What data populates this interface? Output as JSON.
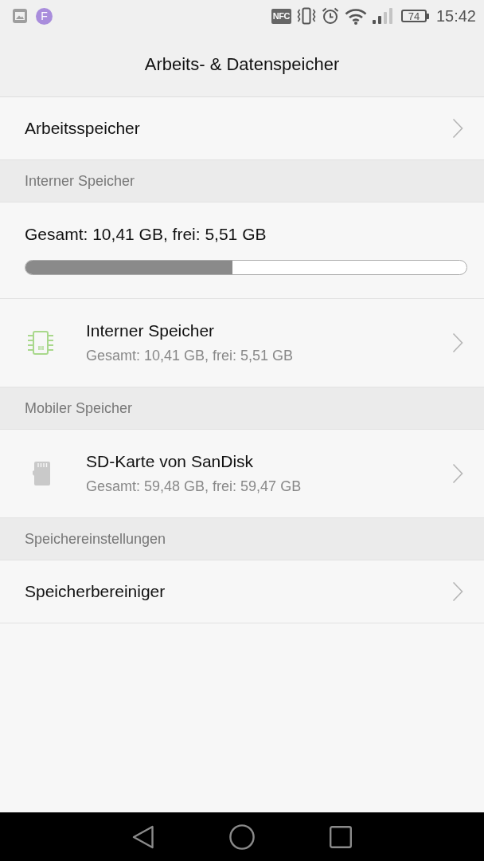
{
  "status_bar": {
    "notification_letter": "F",
    "nfc_label": "NFC",
    "battery": "74",
    "time": "15:42"
  },
  "app_bar": {
    "title": "Arbeits- & Datenspeicher"
  },
  "items": [
    {
      "kind": "link",
      "label": "Arbeitsspeicher"
    },
    {
      "kind": "header",
      "label": "Interner Speicher"
    },
    {
      "kind": "usage",
      "label": "Gesamt: 10,41 GB, frei: 5,51 GB",
      "level": 0.47
    },
    {
      "kind": "internal",
      "title": "Interner Speicher",
      "subtitle": "Gesamt: 10,41 GB, frei: 5,51 GB"
    },
    {
      "kind": "header",
      "label": "Mobiler Speicher"
    },
    {
      "kind": "removable",
      "title": "SD-Karte von SanDisk",
      "subtitle": "Gesamt: 59,48 GB, frei: 59,47 GB"
    },
    {
      "kind": "header",
      "label": "Speichereinstellungen"
    },
    {
      "kind": "link",
      "label": "Speicherbereiniger"
    }
  ]
}
